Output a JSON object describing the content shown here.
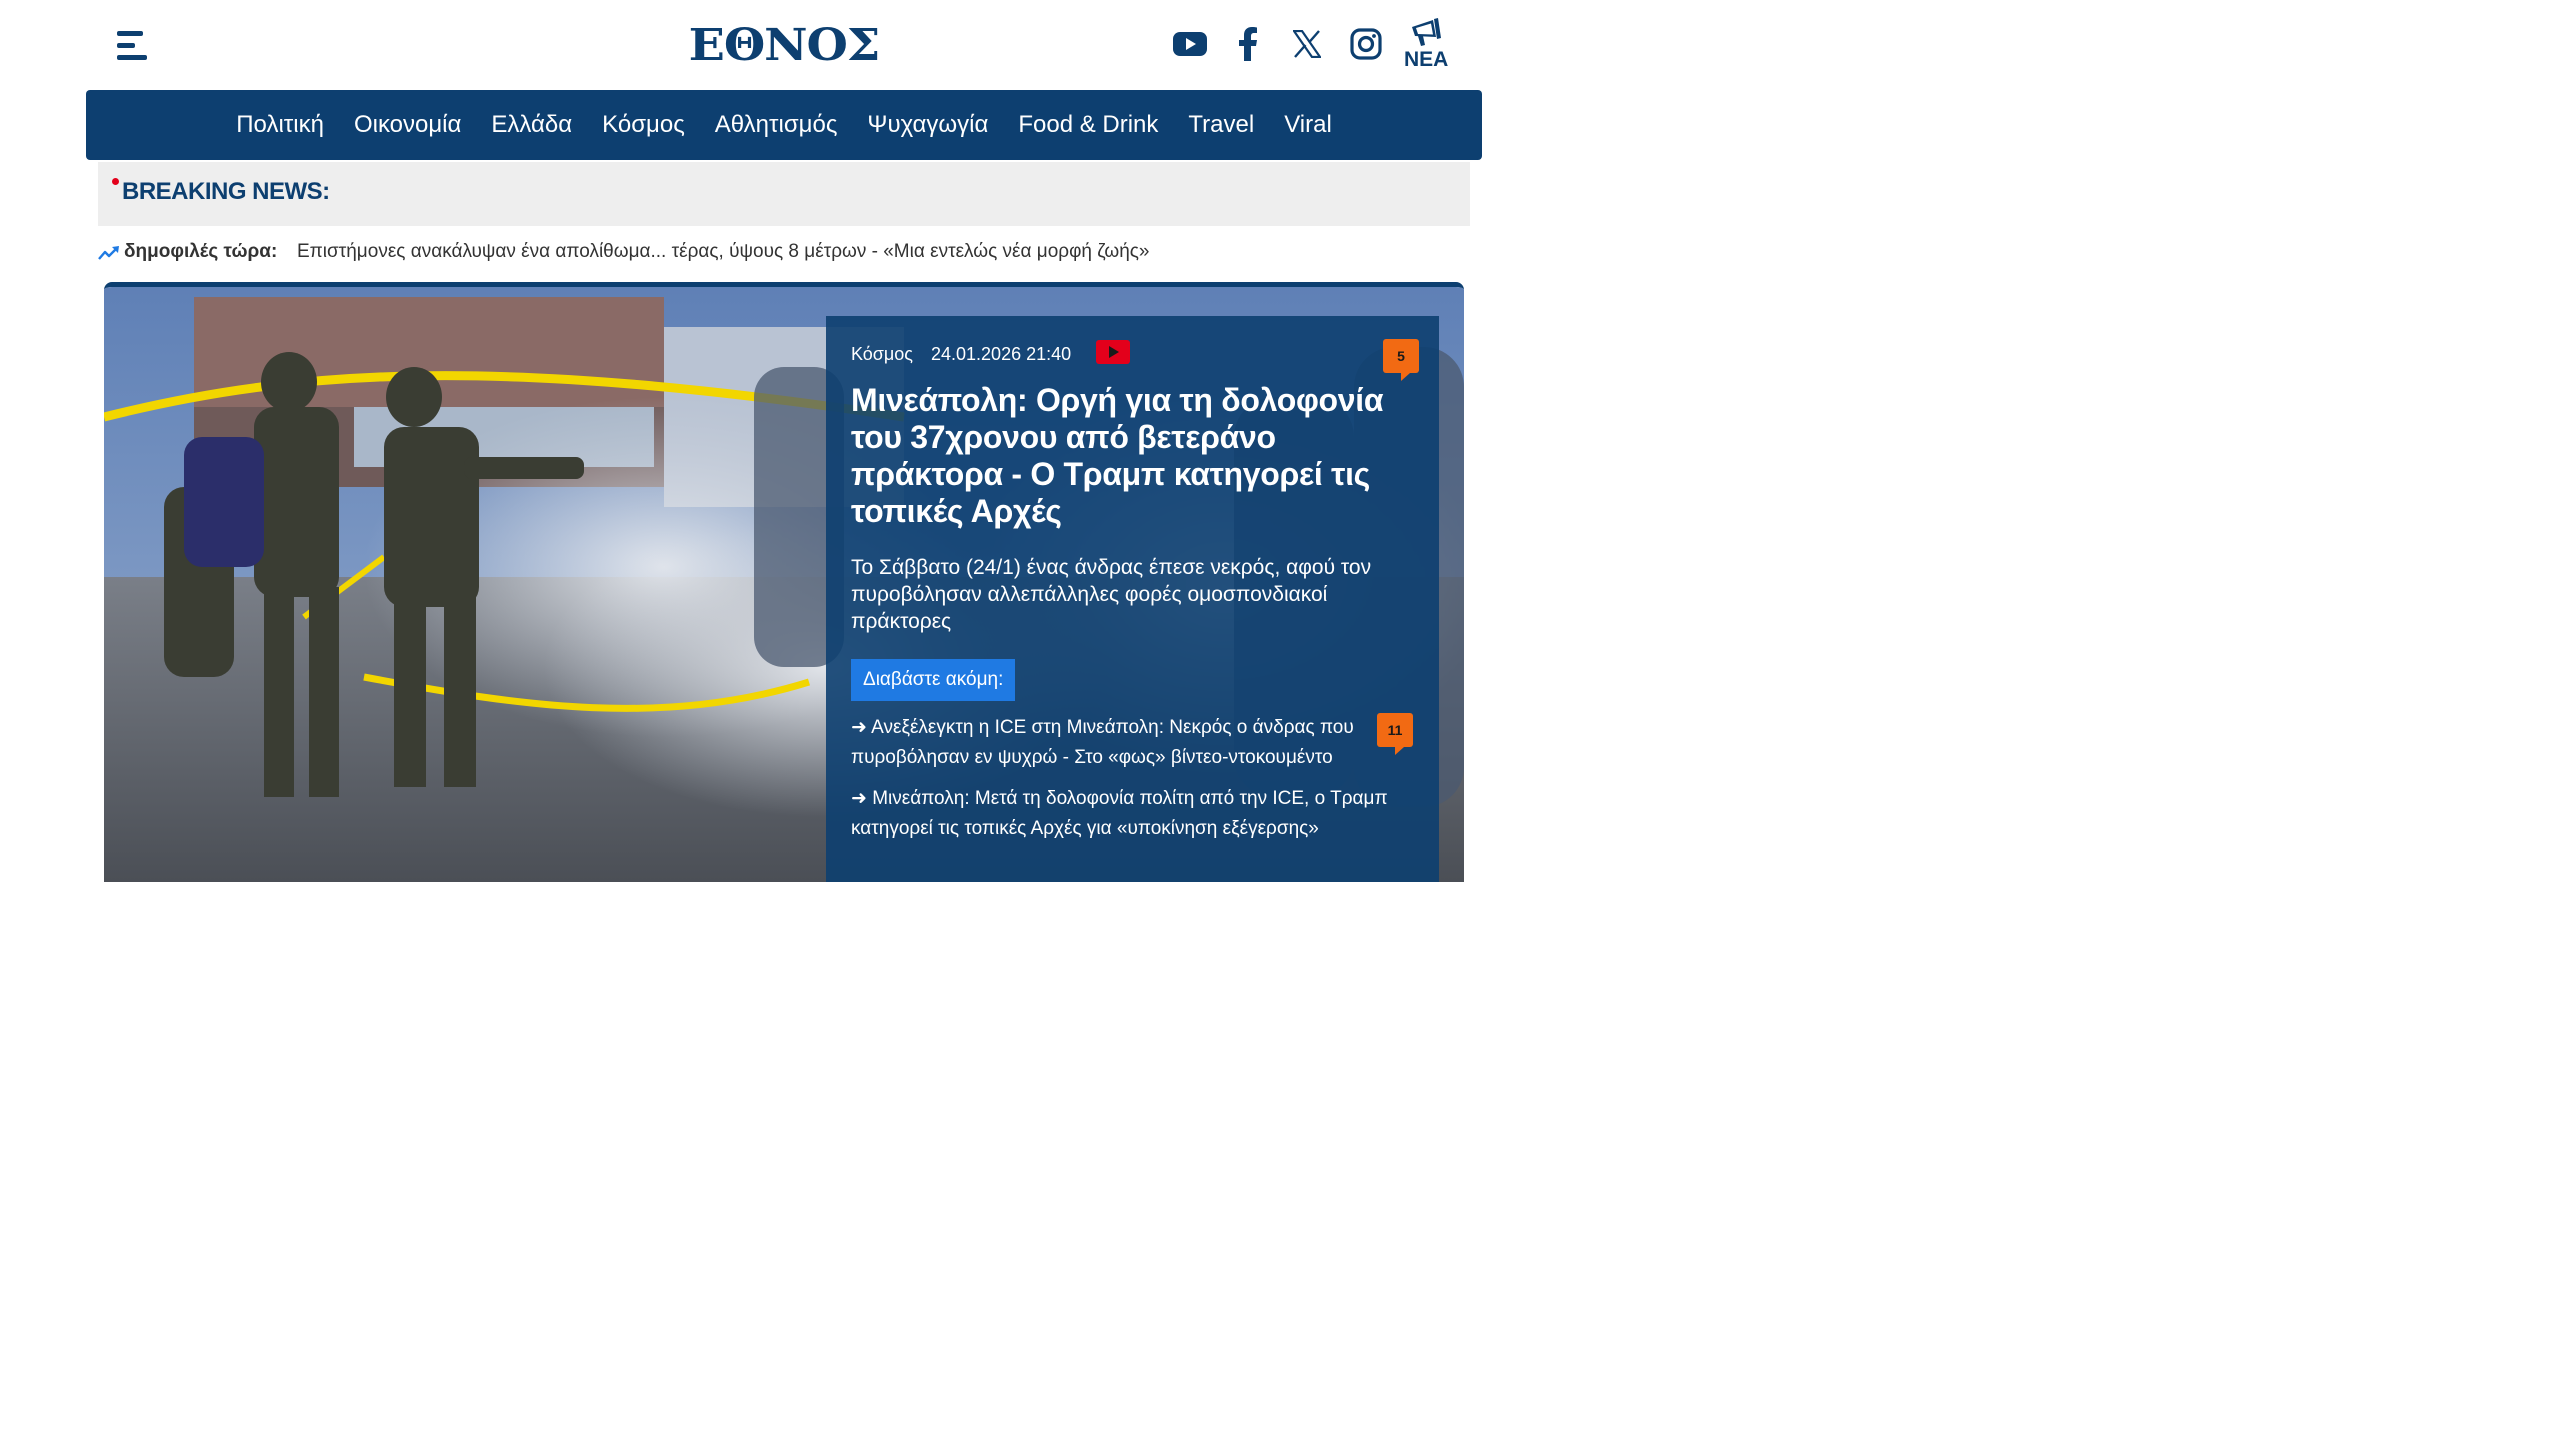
{
  "header": {
    "logo_text": "ΕΘΝΟΣ",
    "nea_label": "ΝΕΑ"
  },
  "nav": {
    "items": [
      {
        "label": "Πολιτική"
      },
      {
        "label": "Οικονομία"
      },
      {
        "label": "Ελλάδα"
      },
      {
        "label": "Κόσμος"
      },
      {
        "label": "Αθλητισμός"
      },
      {
        "label": "Ψυχαγωγία"
      },
      {
        "label": "Food & Drink"
      },
      {
        "label": "Travel"
      },
      {
        "label": "Viral"
      }
    ]
  },
  "breaking": {
    "label": "BREAKING NEWS:"
  },
  "popular": {
    "label": "δημοφιλές τώρα:",
    "link": "Επιστήμονες ανακάλυψαν ένα απολίθωμα... τέρας, ύψους 8 μέτρων - «Μια εντελώς νέα μορφή ζωής»"
  },
  "hero": {
    "category": "Κόσμος",
    "datetime": "24.01.2026 21:40",
    "comments": "5",
    "headline": "Μινεάπολη: Οργή για τη δολοφονία του 37χρονου από βετεράνο πράκτορα - Ο Τραμπ κατηγορεί τις τοπικές Αρχές",
    "summary": "Το Σάββατο (24/1) ένας άνδρας έπεσε νεκρός, αφού τον πυροβόλησαν αλλεπάλληλες φορές ομοσπονδιακοί πράκτορες",
    "read_more": "Διαβάστε ακόμη:",
    "related": [
      {
        "arrow": "➜",
        "text": "Ανεξέλεγκτη η ICE στη Μινεάπολη: Νεκρός ο άνδρας που πυροβόλησαν εν ψυχρώ - Στο «φως» βίντεο-ντοκουμέντο",
        "comments": "11"
      },
      {
        "arrow": "➜",
        "text": "Μινεάπολη: Μετά τη δολοφονία πολίτη από την ICE, ο Τραμπ κατηγορεί τις τοπικές Αρχές για «υποκίνηση εξέγερσης»"
      }
    ]
  },
  "colors": {
    "brand": "#0d3f70",
    "accent": "#f26a13",
    "button": "#1f7ae3",
    "breaking_dot": "#e3001b"
  },
  "icons": [
    "menu-icon",
    "youtube-icon",
    "facebook-icon",
    "x-icon",
    "instagram-icon",
    "megaphone-icon",
    "trending-icon",
    "video-icon",
    "comment-icon"
  ]
}
